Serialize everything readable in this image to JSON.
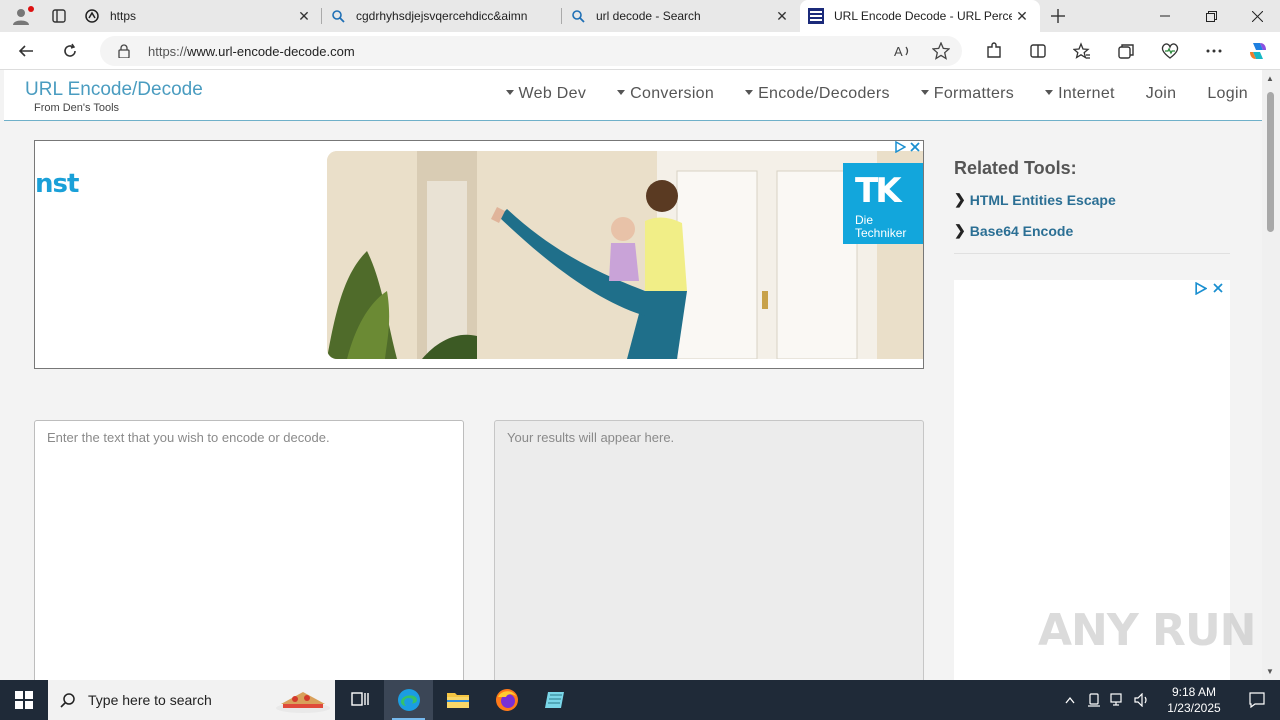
{
  "browser": {
    "tabs": [
      {
        "title": "https",
        "icon": "page-icon",
        "active": false
      },
      {
        "title": "cgdrhyhsdjejsvqercehdicc&aimn",
        "icon": "search-icon",
        "active": false
      },
      {
        "title": "url decode - Search",
        "icon": "search-icon",
        "active": false
      },
      {
        "title": "URL Encode Decode - URL Percen",
        "icon": "site-favicon",
        "active": true
      }
    ],
    "address": {
      "prefix": "https://",
      "host": "www.url-encode-decode.com"
    }
  },
  "site": {
    "brand": "URL Encode/Decode",
    "byline": "From Den's Tools",
    "nav": [
      {
        "label": "Web Dev",
        "dropdown": true
      },
      {
        "label": "Conversion",
        "dropdown": true
      },
      {
        "label": "Encode/Decoders",
        "dropdown": true
      },
      {
        "label": "Formatters",
        "dropdown": true
      },
      {
        "label": "Internet",
        "dropdown": true
      },
      {
        "label": "Join",
        "dropdown": false
      },
      {
        "label": "Login",
        "dropdown": false
      }
    ]
  },
  "ad_top": {
    "brand_fragment": "nst",
    "logo_text": "TK",
    "logo_line1": "Die",
    "logo_line2": "Techniker",
    "accent": "#12a6dc"
  },
  "tool": {
    "input_placeholder": "Enter the text that you wish to encode or decode.",
    "output_placeholder": "Your results will appear here."
  },
  "related": {
    "heading": "Related Tools:",
    "links": [
      "HTML Entities Escape",
      "Base64 Encode"
    ]
  },
  "watermark": "ANY RUN",
  "taskbar": {
    "search_placeholder": "Type here to search",
    "time": "9:18 AM",
    "date": "1/23/2025"
  }
}
